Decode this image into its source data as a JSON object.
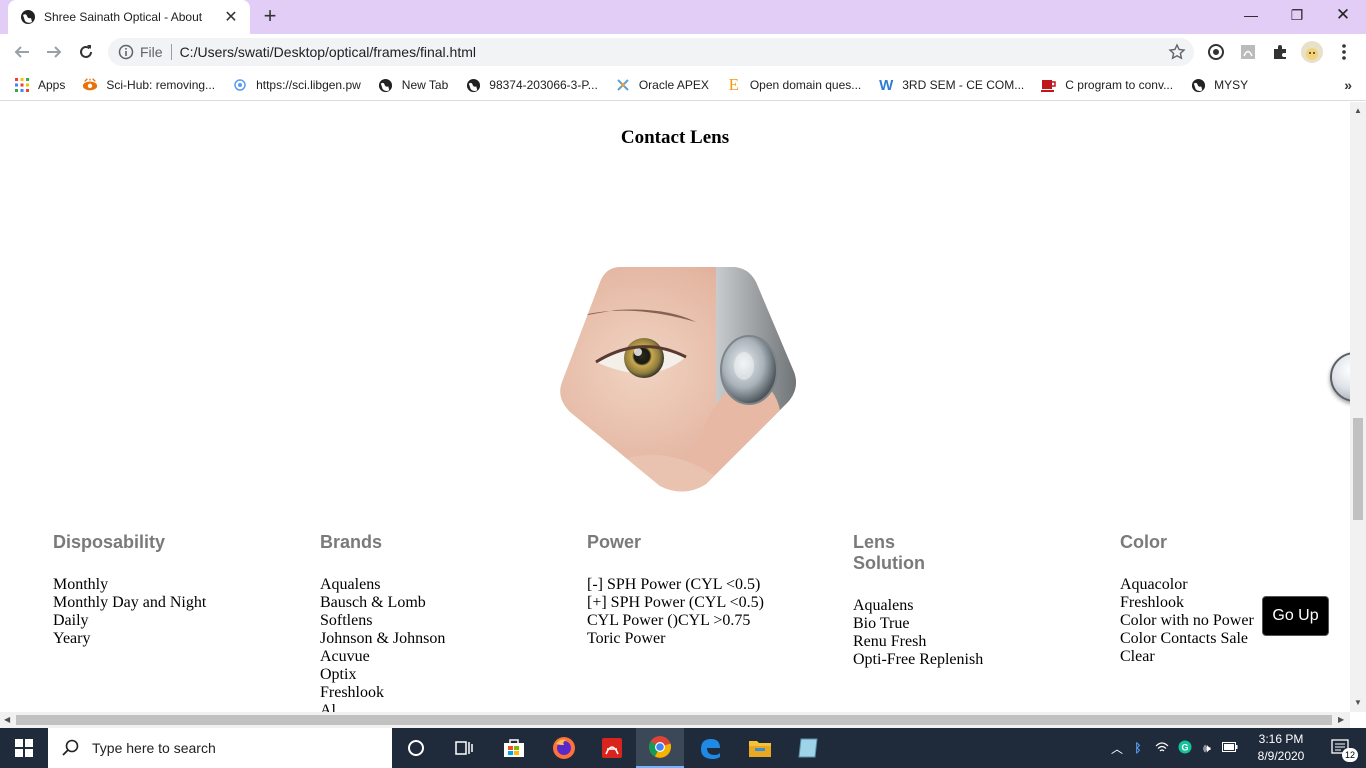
{
  "browser": {
    "tab_title": "Shree Sainath Optical - About",
    "address_scheme": "File",
    "address_url": "C:/Users/swati/Desktop/optical/frames/final.html"
  },
  "bookmarks": [
    {
      "label": "Apps",
      "icon": "apps-grid-icon"
    },
    {
      "label": "Sci-Hub: removing...",
      "icon": "scihub-icon"
    },
    {
      "label": "https://sci.libgen.pw",
      "icon": "libgen-icon"
    },
    {
      "label": "New Tab",
      "icon": "globe-icon"
    },
    {
      "label": "98374-203066-3-P...",
      "icon": "globe-icon"
    },
    {
      "label": "Oracle APEX",
      "icon": "oracle-icon"
    },
    {
      "label": "Open domain ques...",
      "icon": "e-icon"
    },
    {
      "label": "3RD SEM - CE COM...",
      "icon": "w-icon"
    },
    {
      "label": "C program to conv...",
      "icon": "coffee-icon"
    },
    {
      "label": "MYSY",
      "icon": "globe-icon"
    }
  ],
  "page": {
    "heading": "Contact Lens",
    "hero_image": "eye-contact-lens-photo",
    "go_up_label": "Go Up",
    "columns": [
      {
        "title": "Disposability",
        "items": [
          "Monthly",
          "Monthly Day and Night",
          "Daily",
          "Yeary"
        ]
      },
      {
        "title": "Brands",
        "items": [
          "Aqualens",
          "Bausch & Lomb",
          "Softlens",
          "Johnson & Johnson",
          "Acuvue",
          "Optix",
          "Freshlook",
          "Al..."
        ]
      },
      {
        "title": "Power",
        "items": [
          "[-] SPH Power (CYL <0.5)",
          "[+] SPH Power (CYL <0.5)",
          "CYL Power ()CYL >0.75",
          "Toric Power"
        ]
      },
      {
        "title": "Lens Solution",
        "items": [
          "Aqualens",
          "Bio True",
          "Renu Fresh",
          "Opti-Free Replenish"
        ]
      },
      {
        "title": "Color",
        "items": [
          "Aquacolor",
          "Freshlook",
          "Color with no Power",
          "Color Contacts Sale",
          "Clear"
        ]
      }
    ]
  },
  "taskbar": {
    "search_placeholder": "Type here to search",
    "time": "3:16 PM",
    "date": "8/9/2020",
    "notifications": "12"
  },
  "colors": {
    "tabstrip": "#e2cdf7",
    "column_heading": "#7a7a7a",
    "taskbar": "#1f2b3a"
  }
}
